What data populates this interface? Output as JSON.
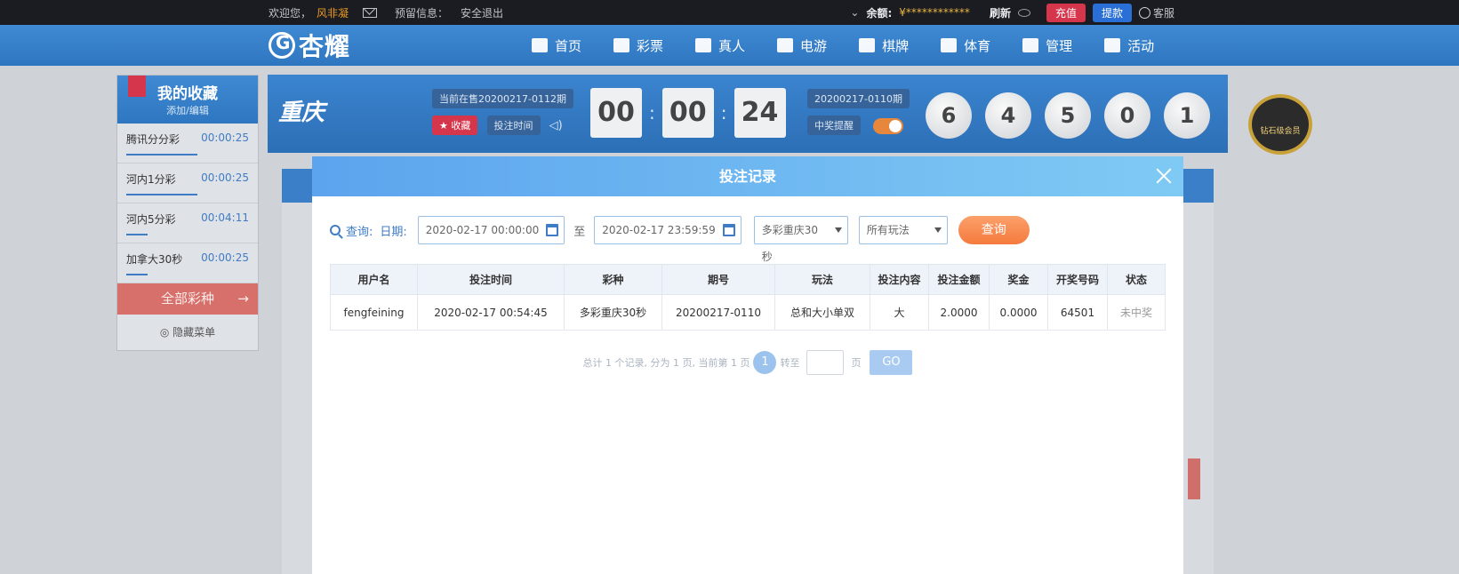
{
  "topbar": {
    "welcome": "欢迎您，",
    "username": "风非凝",
    "reserved_info": "预留信息：",
    "logout": "安全退出",
    "balance_label": "余额:",
    "balance_value": "¥************",
    "refresh": "刷新",
    "recharge": "充值",
    "withdraw": "提款",
    "service": "客服"
  },
  "nav": {
    "logo": "杏耀",
    "items": [
      {
        "label": "首页",
        "icon": "home-icon"
      },
      {
        "label": "彩票",
        "icon": "ticket-icon"
      },
      {
        "label": "真人",
        "icon": "person-icon"
      },
      {
        "label": "电游",
        "icon": "slot-icon"
      },
      {
        "label": "棋牌",
        "icon": "cards-icon"
      },
      {
        "label": "体育",
        "icon": "trophy-icon"
      },
      {
        "label": "管理",
        "icon": "users-icon"
      },
      {
        "label": "活动",
        "icon": "gift-icon"
      }
    ]
  },
  "favorites": {
    "title": "我的收藏",
    "edit": "添加/编辑",
    "items": [
      {
        "name": "腾讯分分彩",
        "time": "00:00:25"
      },
      {
        "name": "河内1分彩",
        "time": "00:00:25"
      },
      {
        "name": "河内5分彩",
        "time": "00:04:11"
      },
      {
        "name": "加拿大30秒",
        "time": "00:00:25"
      }
    ],
    "all": "全部彩种",
    "hide": "隐藏菜单"
  },
  "game": {
    "logo": "重庆",
    "current_issue": "当前在售20200217-0112期",
    "favorite": "收藏",
    "bet_time": "投注时间",
    "countdown": [
      "00",
      "00",
      "24"
    ],
    "prev_issue": "20200217-0110期",
    "win_remind": "中奖提醒",
    "balls": [
      "6",
      "4",
      "5",
      "0",
      "1"
    ]
  },
  "badge": {
    "text": "钻石级会员"
  },
  "modal": {
    "title": "投注记录",
    "query_label": "查询:",
    "date_label": "日期:",
    "date_from": "2020-02-17 00:00:00",
    "date_to_sep": "至",
    "date_to": "2020-02-17 23:59:59",
    "lottery_select": "多彩重庆30秒",
    "play_select": "所有玩法",
    "query_button": "查询",
    "columns": [
      "用户名",
      "投注时间",
      "彩种",
      "期号",
      "玩法",
      "投注内容",
      "投注金额",
      "奖金",
      "开奖号码",
      "状态"
    ],
    "rows": [
      [
        "fengfeining",
        "2020-02-17 00:54:45",
        "多彩重庆30秒",
        "20200217-0110",
        "总和大小单双",
        "大",
        "2.0000",
        "0.0000",
        "64501",
        "未中奖"
      ]
    ],
    "pager": {
      "summary": "总计 1 个记录, 分为 1 页, 当前第 1 页",
      "current": "1",
      "goto": "转至",
      "page_unit": "页",
      "go": "GO"
    }
  },
  "colors": {
    "accent": "#3f7cc5",
    "nav": "#2f76c0",
    "danger": "#d6364c",
    "query": "#f57a3d"
  }
}
